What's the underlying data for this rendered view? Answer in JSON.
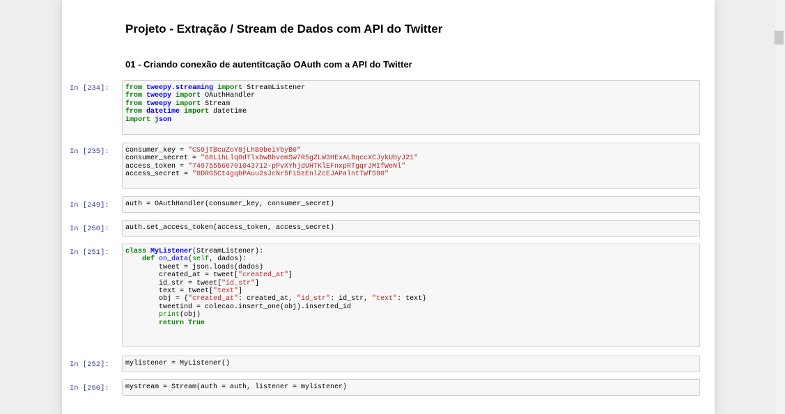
{
  "title": "Projeto - Extração / Stream de Dados com API do Twitter",
  "subtitle": "01 - Criando conexão de autentitcação OAuth com a API do Twitter",
  "cells": [
    {
      "prompt": "In [234]:"
    },
    {
      "prompt": "In [235]:"
    },
    {
      "prompt": "In [249]:"
    },
    {
      "prompt": "In [250]:"
    },
    {
      "prompt": "In [251]:"
    },
    {
      "prompt": "In [252]:"
    },
    {
      "prompt": "In [260]:"
    }
  ],
  "code": {
    "c234": {
      "l1a": "from",
      "l1b": "tweepy.streaming",
      "l1c": "import",
      "l1d": " StreamListener",
      "l2a": "from",
      "l2b": "tweepy",
      "l2c": "import",
      "l2d": " OAuthHandler",
      "l3a": "from",
      "l3b": "tweepy",
      "l3c": "import",
      "l3d": " Stream",
      "l4a": "from",
      "l4b": "datetime",
      "l4c": "import",
      "l4d": " datetime",
      "l5a": "import",
      "l5b": "json"
    },
    "c235": {
      "l1a": "consumer_key = ",
      "l1b": "\"CS9jTBcuZoY8jLhB9beiYbyB0\"",
      "l2a": "consumer_secret = ",
      "l2b": "\"68LihLlq0dTlxbwBbvemSw7R5gZLW3HExALBqccXCJykUbyJ21\"",
      "l3a": "access_token = ",
      "l3b": "\"749755566701043712-pPvXYhjdUHTKlEFnxpRTgqrJMIfWeNl\"",
      "l4a": "access_secret = ",
      "l4b": "\"0DRG5Ct4gqbPAuu2sJcNr5Fi5zEnlZcEJAPalntTWfS90\""
    },
    "c249": "auth = OAuthHandler(consumer_key, consumer_secret)",
    "c250": "auth.set_access_token(access_token, access_secret)",
    "c251": {
      "l1a": "class",
      "l1b": "MyListener",
      "l1c": "(StreamListener):",
      "l2a": "    ",
      "l2b": "def",
      "l2c": "on_data",
      "l2d": "(",
      "l2e": "self",
      "l2f": ", dados):",
      "l3": "        tweet = json.loads(dados)",
      "l4a": "        created_at = tweet[",
      "l4b": "\"created_at\"",
      "l4c": "]",
      "l5a": "        id_str = tweet[",
      "l5b": "\"id_str\"",
      "l5c": "]",
      "l6a": "        text = tweet[",
      "l6b": "\"text\"",
      "l6c": "]",
      "l7a": "        obj = {",
      "l7b": "\"created_at\"",
      "l7c": ": created_at, ",
      "l7d": "\"id_str\"",
      "l7e": ": id_str, ",
      "l7f": "\"text\"",
      "l7g": ": text}",
      "l8": "        tweetind = colecao.insert_one(obj).inserted_id",
      "l9a": "        ",
      "l9b": "print",
      "l9c": "(obj)",
      "l10a": "        ",
      "l10b": "return",
      "l10c": "True"
    },
    "c252": "mylistener = MyListener()",
    "c260": "mystream = Stream(auth = auth, listener = mylistener)"
  }
}
